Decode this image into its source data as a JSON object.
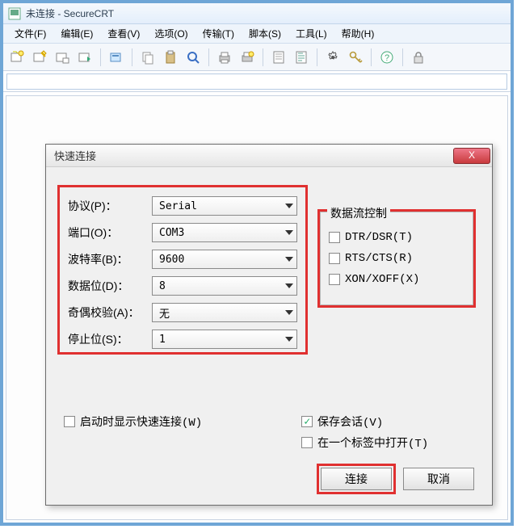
{
  "window": {
    "title": "未连接 - SecureCRT"
  },
  "menu": {
    "file": "文件(F)",
    "edit": "编辑(E)",
    "view": "查看(V)",
    "options": "选项(O)",
    "transfer": "传输(T)",
    "script": "脚本(S)",
    "tools": "工具(L)",
    "help": "帮助(H)"
  },
  "dialog": {
    "title": "快速连接",
    "params": {
      "protocol_label": "协议(P)：",
      "protocol_value": "Serial",
      "port_label": "端口(O)：",
      "port_value": "COM3",
      "baud_label": "波特率(B)：",
      "baud_value": "9600",
      "data_label": "数据位(D)：",
      "data_value": "8",
      "parity_label": "奇偶校验(A)：",
      "parity_value": "无",
      "stop_label": "停止位(S)：",
      "stop_value": "1"
    },
    "flow": {
      "group_title": "数据流控制",
      "dtr": "DTR/DSR(T)",
      "rts": "RTS/CTS(R)",
      "xon": "XON/XOFF(X)"
    },
    "opts": {
      "show_quick": "启动时显示快速连接(W)",
      "save_session": "保存会话(V)",
      "open_in_tab": "在一个标签中打开(T)"
    },
    "buttons": {
      "connect": "连接",
      "cancel": "取消"
    }
  }
}
